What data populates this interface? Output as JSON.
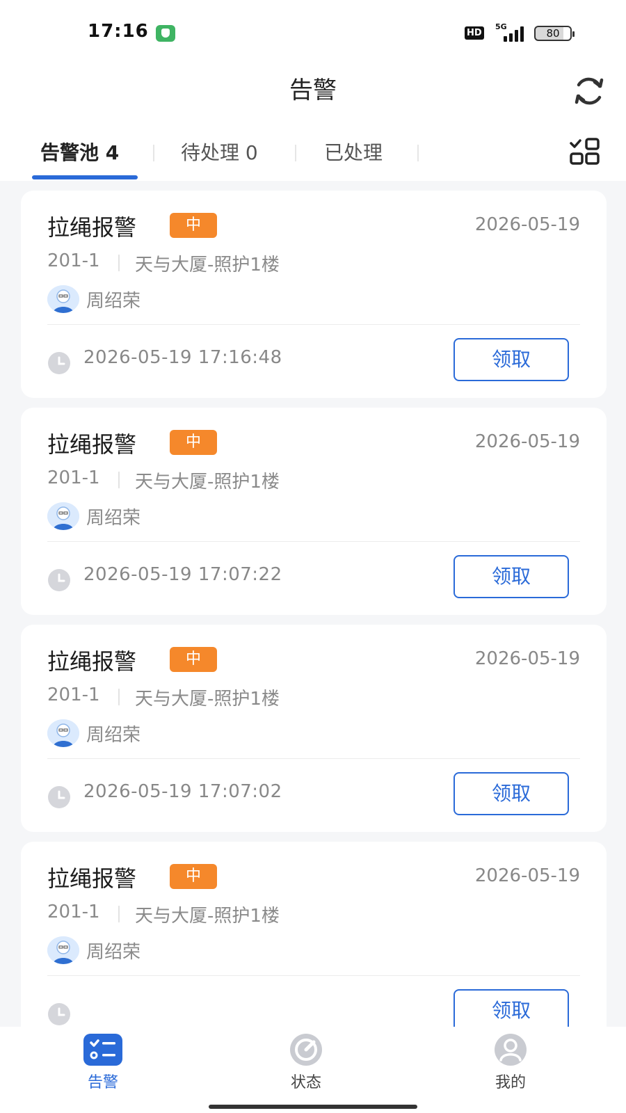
{
  "status_bar": {
    "time": "17:16",
    "network_hd": "HD",
    "network_type": "5G",
    "battery": "80"
  },
  "header": {
    "title": "告警",
    "refresh_icon": "refresh-icon"
  },
  "tabs": [
    {
      "label": "告警池 4",
      "active": true
    },
    {
      "label": "待处理 0",
      "active": false
    },
    {
      "label": "已处理",
      "active": false
    }
  ],
  "tabs_icon": "grid-check-icon",
  "alerts": [
    {
      "title": "拉绳报警",
      "level": "中",
      "date": "2026-05-19",
      "room": "201-1",
      "location": "天与大厦-照护1楼",
      "person": "周绍荣",
      "time": "2026-05-19 17:16:48",
      "action": "领取"
    },
    {
      "title": "拉绳报警",
      "level": "中",
      "date": "2026-05-19",
      "room": "201-1",
      "location": "天与大厦-照护1楼",
      "person": "周绍荣",
      "time": "2026-05-19 17:07:22",
      "action": "领取"
    },
    {
      "title": "拉绳报警",
      "level": "中",
      "date": "2026-05-19",
      "room": "201-1",
      "location": "天与大厦-照护1楼",
      "person": "周绍荣",
      "time": "2026-05-19 17:07:02",
      "action": "领取"
    },
    {
      "title": "拉绳报警",
      "level": "中",
      "date": "2026-05-19",
      "room": "201-1",
      "location": "天与大厦-照护1楼",
      "person": "周绍荣",
      "time": "",
      "action": "领取"
    }
  ],
  "bottom_nav": [
    {
      "label": "告警",
      "icon": "checklist-icon",
      "active": true
    },
    {
      "label": "状态",
      "icon": "gauge-icon",
      "active": false
    },
    {
      "label": "我的",
      "icon": "user-icon",
      "active": false
    }
  ],
  "colors": {
    "accent": "#2a6ad8",
    "badge": "#f5882b",
    "background": "#f5f6f8"
  }
}
